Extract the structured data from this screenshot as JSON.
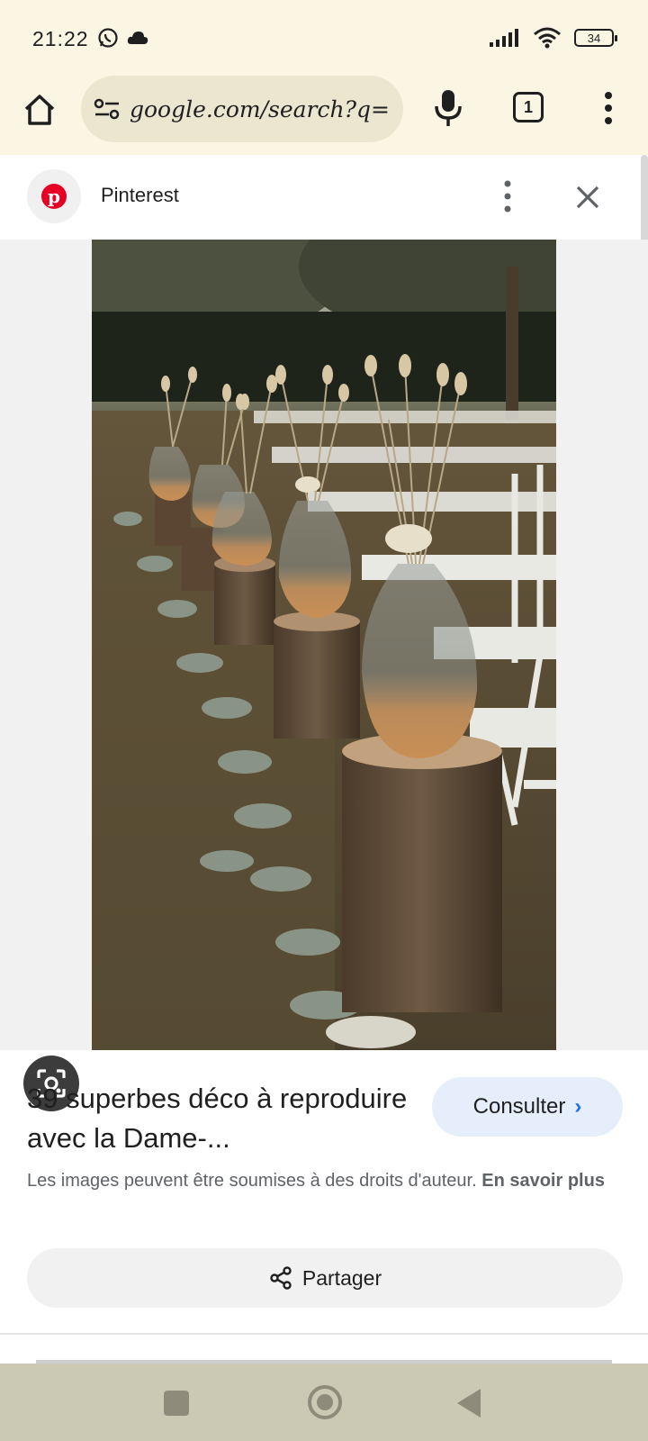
{
  "status_bar": {
    "time": "21:22",
    "battery": "34",
    "icons": [
      "whatsapp-icon",
      "cloud-icon",
      "signal-icon",
      "wifi-icon",
      "battery-icon"
    ]
  },
  "browser": {
    "url": "google.com/search?q=",
    "tab_count": "1"
  },
  "panel": {
    "source_name": "Pinterest",
    "title": "39 superbes déco à reproduire avec la Dame-...",
    "consult_label": "Consulter",
    "copyright_text": "Les images peuvent être soumises à des droits d'auteur.",
    "learn_more": "En savoir plus",
    "share_label": "Partager"
  },
  "colors": {
    "chrome_bg": "#faf6e3",
    "omnibox_bg": "#eae6d0",
    "pinterest_red": "#e60023",
    "consult_bg": "#e6eefb",
    "link_blue": "#1a73e8",
    "nav_bar_bg": "#cbc8b4"
  }
}
